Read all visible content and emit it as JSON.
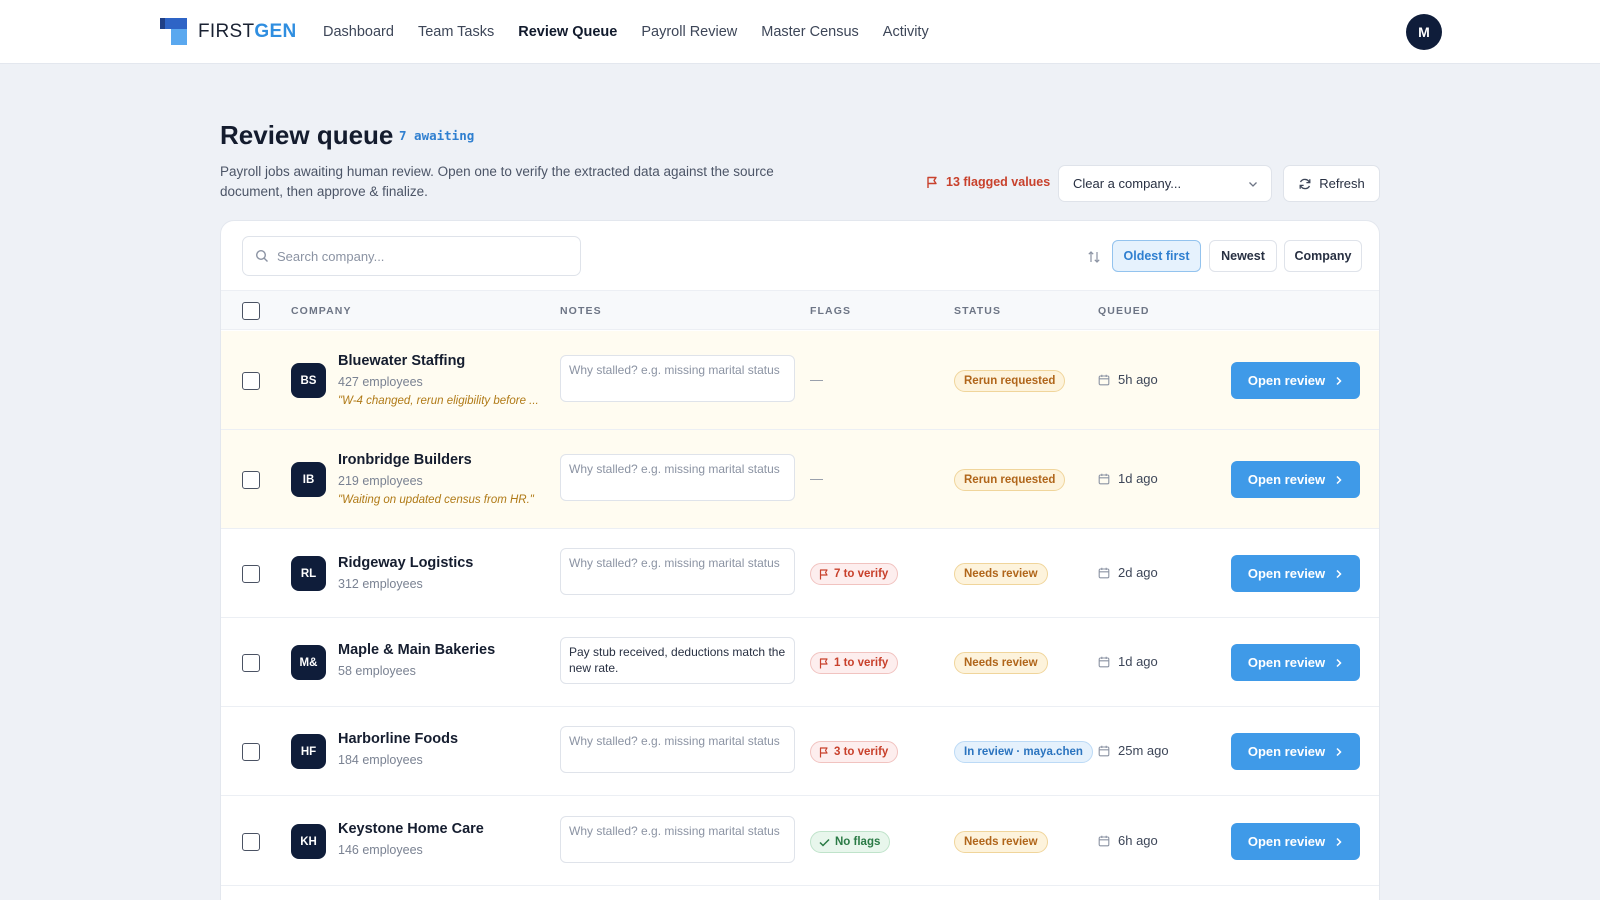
{
  "app": {
    "logo_first": "FIRST",
    "logo_gen": "GEN",
    "nav": [
      "Dashboard",
      "Team Tasks",
      "Review Queue",
      "Payroll Review",
      "Master Census",
      "Activity"
    ],
    "active_nav": "Review Queue",
    "avatar_initial": "M"
  },
  "header": {
    "title": "Review queue",
    "awaiting": "7 awaiting",
    "description": "Payroll jobs awaiting human review. Open one to verify the extracted data against the source document, then approve & finalize.",
    "flagged": "13 flagged values",
    "clear_select": "Clear a company...",
    "refresh": "Refresh"
  },
  "toolbar": {
    "search_placeholder": "Search company...",
    "sort_options": [
      "Oldest first",
      "Newest",
      "Company"
    ],
    "active_sort": "Oldest first"
  },
  "table": {
    "columns": [
      "COMPANY",
      "NOTES",
      "FLAGS",
      "STATUS",
      "QUEUED"
    ],
    "notes_placeholder": "Why stalled? e.g. missing marital status",
    "open_label": "Open review",
    "rows": [
      {
        "initials": "BS",
        "name": "Bluewater Staffing",
        "employees": "427 employees",
        "note": "\"W-4 changed, rerun eligibility before ...",
        "notes_value": "",
        "flags": "—",
        "flag_kind": "none",
        "status": "Rerun requested",
        "status_kind": "rerun",
        "queued": "5h ago"
      },
      {
        "initials": "IB",
        "name": "Ironbridge Builders",
        "employees": "219 employees",
        "note": "\"Waiting on updated census from HR.\"",
        "notes_value": "",
        "flags": "—",
        "flag_kind": "none",
        "status": "Rerun requested",
        "status_kind": "rerun",
        "queued": "1d ago"
      },
      {
        "initials": "RL",
        "name": "Ridgeway Logistics",
        "employees": "312 employees",
        "note": "",
        "notes_value": "",
        "flags": "7 to verify",
        "flag_kind": "flag",
        "status": "Needs review",
        "status_kind": "needs",
        "queued": "2d ago"
      },
      {
        "initials": "M&",
        "name": "Maple & Main Bakeries",
        "employees": "58 employees",
        "note": "",
        "notes_value": "Pay stub received, deductions match the new rate.",
        "flags": "1 to verify",
        "flag_kind": "flag",
        "status": "Needs review",
        "status_kind": "needs",
        "queued": "1d ago"
      },
      {
        "initials": "HF",
        "name": "Harborline Foods",
        "employees": "184 employees",
        "note": "",
        "notes_value": "",
        "flags": "3 to verify",
        "flag_kind": "flag",
        "status": "In review · maya.chen",
        "status_kind": "inreview",
        "queued": "25m ago"
      },
      {
        "initials": "KH",
        "name": "Keystone Home Care",
        "employees": "146 employees",
        "note": "",
        "notes_value": "",
        "flags": "No flags",
        "flag_kind": "ok",
        "status": "Needs review",
        "status_kind": "needs",
        "queued": "6h ago"
      }
    ]
  },
  "colors": {
    "accent": "#3f9ae8",
    "brand_dark": "#0f1d3a",
    "flag_red": "#c8412c",
    "status_amber": "#b0651a",
    "rerun_row_bg": "#fffcf1"
  }
}
